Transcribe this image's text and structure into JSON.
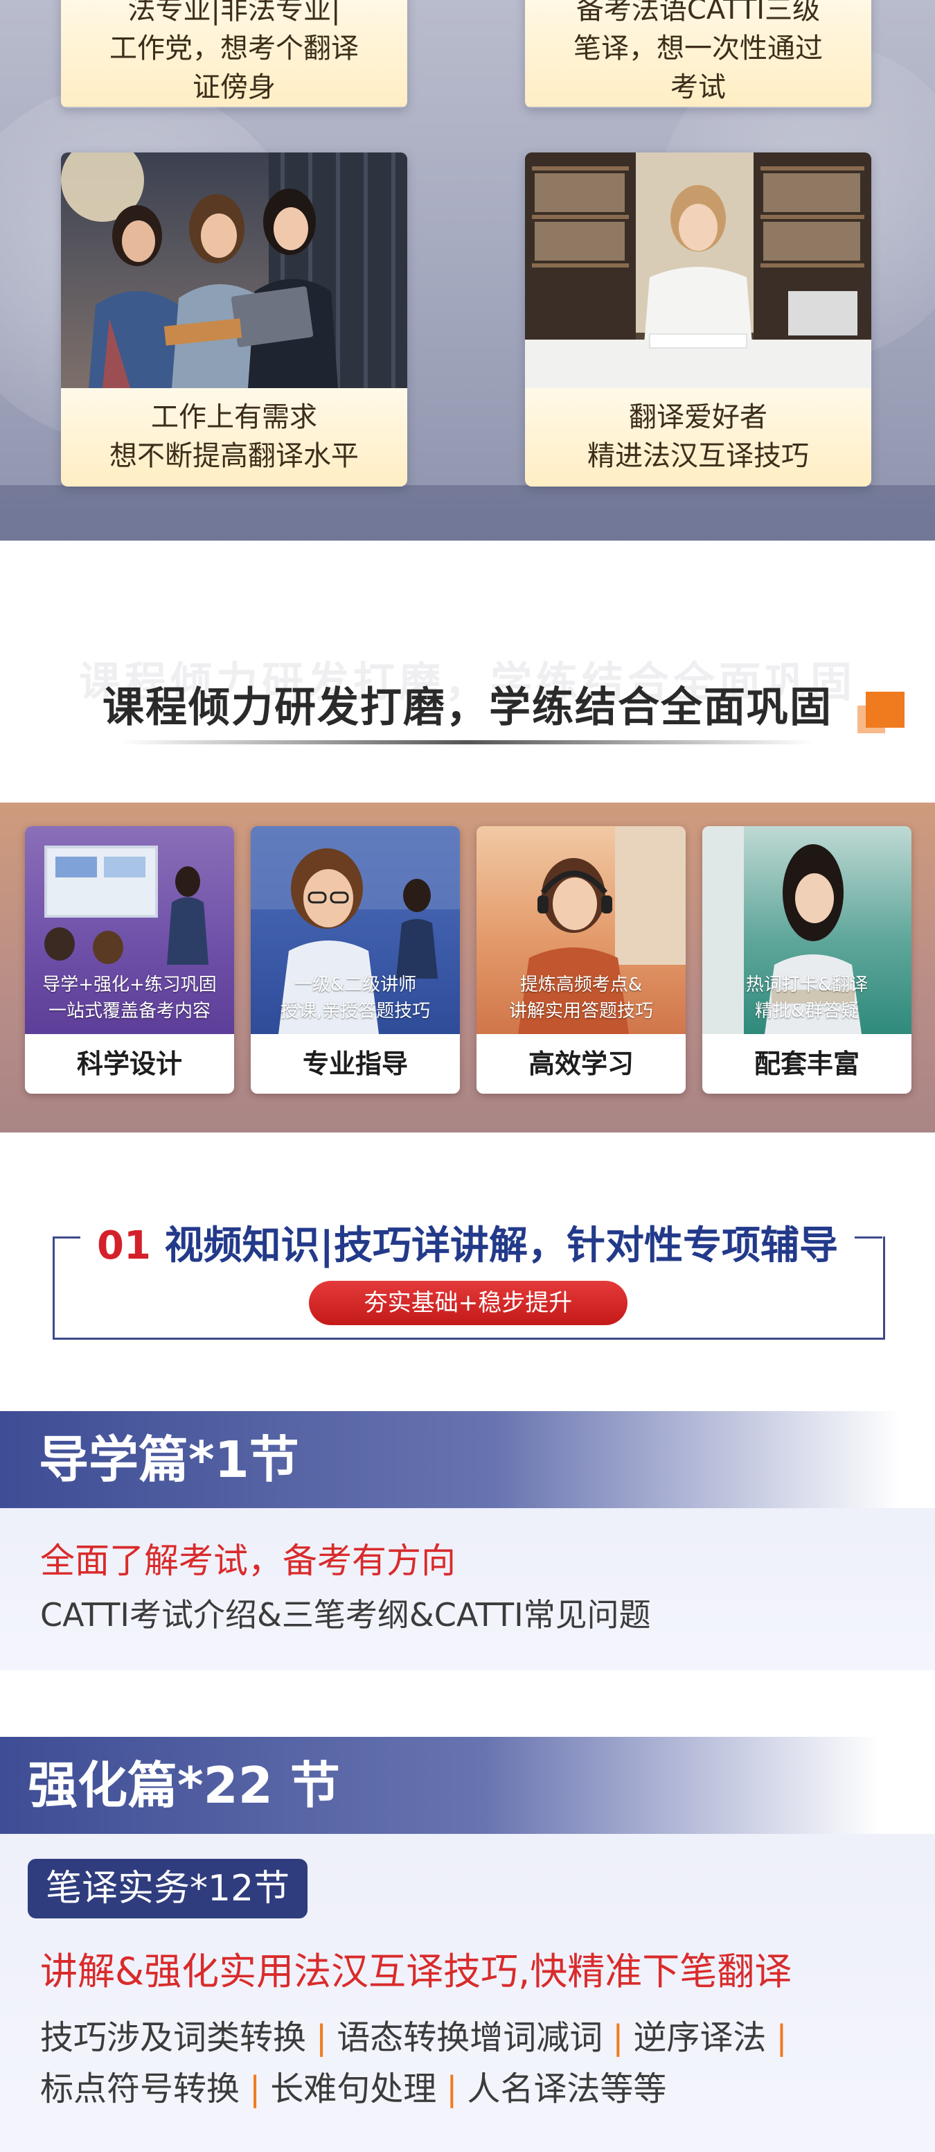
{
  "audience": {
    "top_left_lines": [
      "法专业|非法专业|",
      "工作党，想考个翻译",
      "证傍身"
    ],
    "top_right_lines": [
      "备考法语CATTI三级",
      "笔译，想一次性通过",
      "考试"
    ],
    "cards": [
      {
        "line1": "工作上有需求",
        "line2": "想不断提高翻译水平"
      },
      {
        "line1": "翻译爱好者",
        "line2": "精进法汉互译技巧"
      }
    ]
  },
  "course_section": {
    "title": "课程倾力研发打磨，学练结合全面巩固",
    "watermark": "课程倾力研发打磨，学练结合全面巩固"
  },
  "features": [
    {
      "desc1": "导学+强化+练习巩固",
      "desc2": "一站式覆盖备考内容",
      "label": "科学设计"
    },
    {
      "desc1": "一级&二级讲师",
      "desc2": "授课,亲授答题技巧",
      "label": "专业指导"
    },
    {
      "desc1": "提炼高频考点&",
      "desc2": "讲解实用答题技巧",
      "label": "高效学习"
    },
    {
      "desc1": "热词打卡&翻译",
      "desc2": "精批&群答疑",
      "label": "配套丰富"
    }
  ],
  "video_section": {
    "num": "01",
    "title": "视频知识|技巧详讲解，针对性专项辅导",
    "pill": "夯实基础+稳步提升"
  },
  "intro_section": {
    "band": "导学篇*1节",
    "headline": "全面了解考试，备考有方向",
    "detail": "CATTI考试介绍&三笔考纲&CATTI常见问题"
  },
  "strengthen_section": {
    "band": "强化篇*22 节",
    "tag": "笔译实务*12节",
    "headline": "讲解&强化实用法汉互译技巧,快精准下笔翻译",
    "items_row1": [
      "技巧涉及词类转换",
      "语态转换增词减词",
      "逆序译法"
    ],
    "items_row2": [
      "标点符号转换",
      "长难句处理",
      "人名译法等等"
    ],
    "separator": "|"
  },
  "colors": {
    "accent_blue": "#2f3d7e",
    "accent_red": "#d92b2b",
    "accent_orange": "#f07a1e"
  }
}
